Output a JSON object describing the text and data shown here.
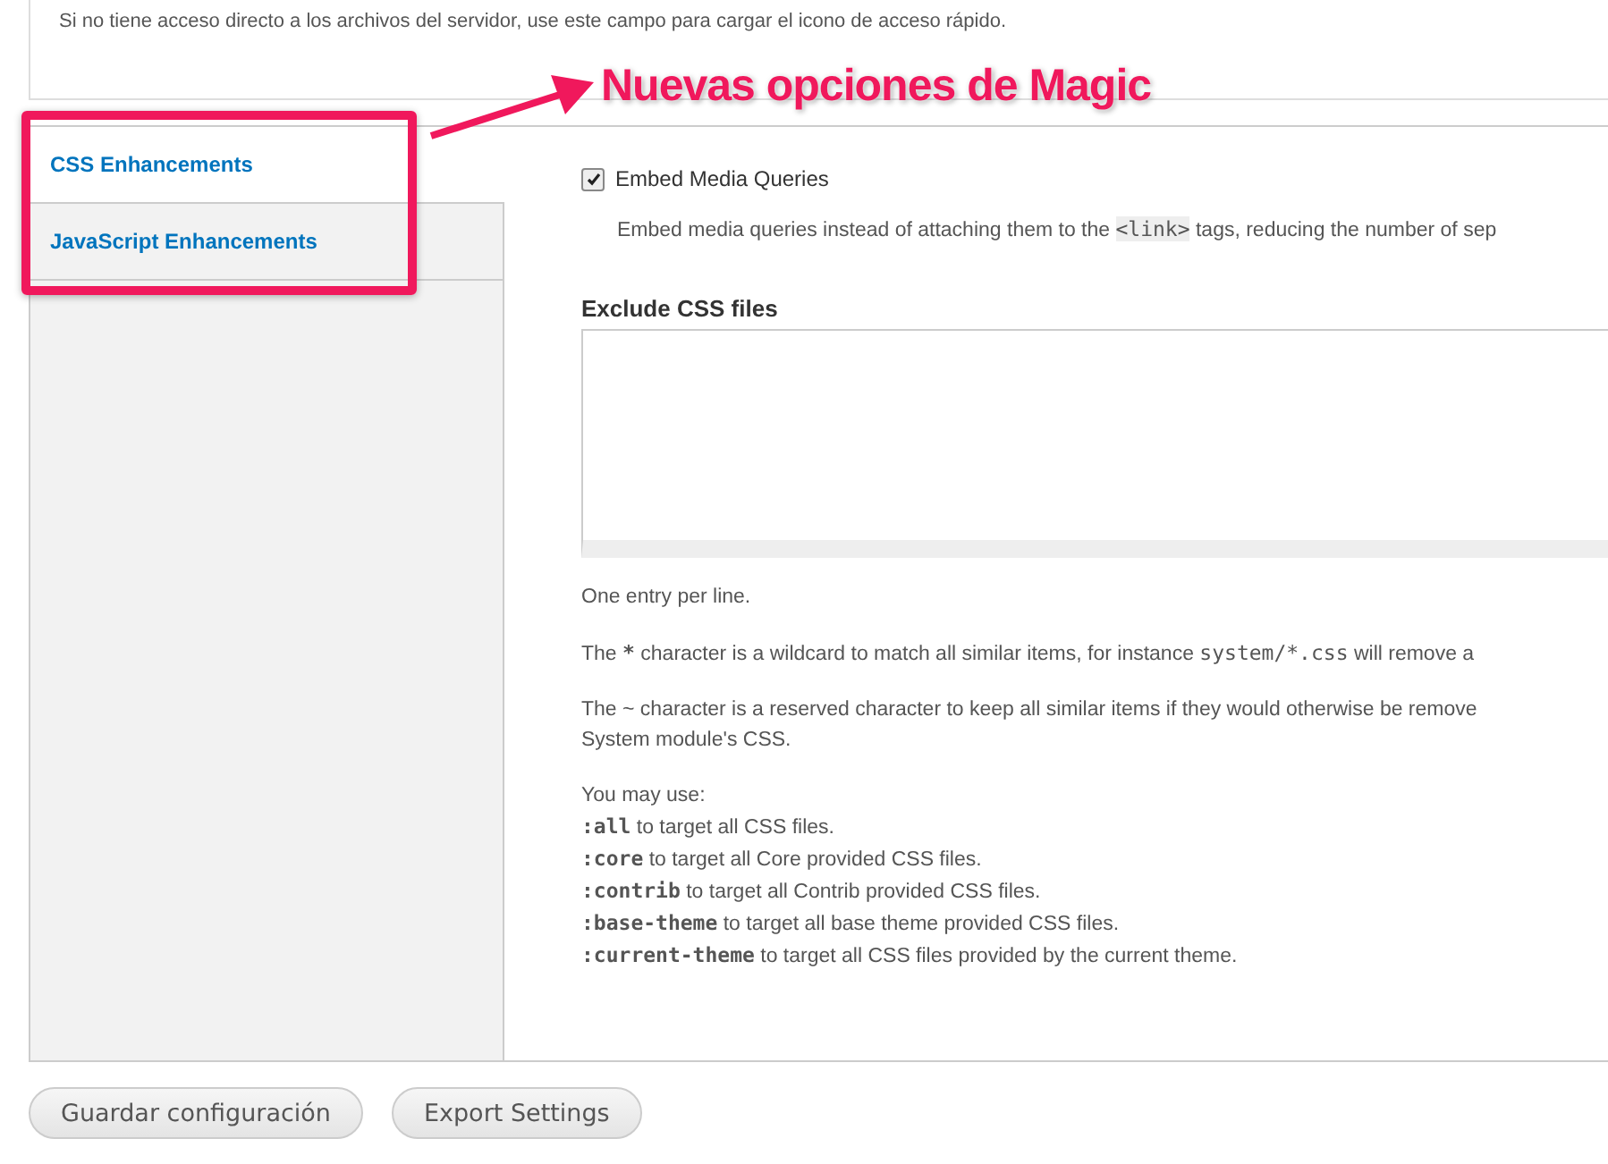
{
  "top_description": "Si no tiene acceso directo a los archivos del servidor, use este campo para cargar el icono de acceso rápido.",
  "annotation": {
    "label": "Nuevas opciones de Magic"
  },
  "tabs": [
    {
      "label": "CSS Enhancements",
      "selected": true
    },
    {
      "label": "JavaScript Enhancements",
      "selected": false
    }
  ],
  "checkbox": {
    "label": "Embed Media Queries",
    "checked": true,
    "description": [
      {
        "kind": "text",
        "text": "Embed media queries instead of attaching them to the "
      },
      {
        "kind": "code",
        "text": "<link>"
      },
      {
        "kind": "text",
        "text": " tags, reducing the number of sep"
      }
    ]
  },
  "exclude_field": {
    "label": "Exclude CSS files"
  },
  "help": [
    [
      {
        "kind": "text",
        "text": "One entry per line."
      }
    ],
    [
      {
        "kind": "text",
        "text": "The "
      },
      {
        "kind": "strong",
        "text": "*"
      },
      {
        "kind": "text",
        "text": " character is a wildcard to match all similar items, for instance "
      },
      {
        "kind": "mono",
        "text": "system/*.css"
      },
      {
        "kind": "text",
        "text": " will remove a"
      }
    ],
    [
      {
        "kind": "text",
        "text": "The ~ character is a reserved character to keep all similar items if they would otherwise be remove"
      },
      {
        "kind": "break"
      },
      {
        "kind": "text",
        "text": "System module's CSS."
      }
    ]
  ],
  "usage_intro": "You may use:",
  "usage": [
    {
      "code": ":all",
      "text": " to target all CSS files."
    },
    {
      "code": ":core",
      "text": " to target all Core provided CSS files."
    },
    {
      "code": ":contrib",
      "text": " to target all Contrib provided CSS files."
    },
    {
      "code": ":base-theme",
      "text": " to target all base theme provided CSS files."
    },
    {
      "code": ":current-theme",
      "text": " to target all CSS files provided by the current theme."
    }
  ],
  "buttons": [
    "Guardar configuración",
    "Export Settings"
  ]
}
